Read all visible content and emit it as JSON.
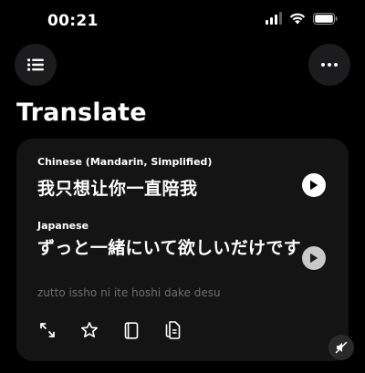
{
  "status_bar": {
    "time": "00:21"
  },
  "header": {
    "title": "Translate"
  },
  "icons": {
    "menu": "list-icon",
    "more": "ellipsis-icon",
    "play": "play-icon",
    "expand": "expand-icon",
    "favorite": "star-icon",
    "dictionary": "book-icon",
    "copy": "copy-icon",
    "mute": "speaker-mute-icon"
  },
  "translation": {
    "source": {
      "language": "Chinese (Mandarin, Simplified)",
      "text": "我只想让你一直陪我"
    },
    "target": {
      "language": "Japanese",
      "text": "ずっと一緒にいて欲しいだけです",
      "romanization": "zutto issho ni ite hoshi dake desu"
    }
  },
  "colors": {
    "background": "#000000",
    "card": "#141414",
    "button": "#1c1c1e",
    "muted_text": "#6e6e6e"
  }
}
